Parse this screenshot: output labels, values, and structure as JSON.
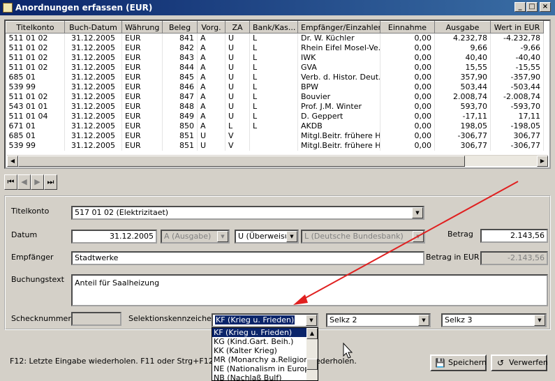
{
  "window": {
    "title": "Anordnungen erfassen (EUR)",
    "min_label": "_",
    "max_label": "□",
    "close_label": "×"
  },
  "grid": {
    "columns": [
      "Titelkonto",
      "Buch-Datum",
      "Währung",
      "Beleg",
      "Vorg.",
      "ZA",
      "Bank/Kas...",
      "Empfänger/Einzahler",
      "Einnahme",
      "Ausgabe",
      "Wert in EUR"
    ],
    "rows": [
      [
        "511 01 02",
        "31.12.2005",
        "EUR",
        "841",
        "A",
        "U",
        "L",
        "Dr. W. Küchler",
        "0,00",
        "4.232,78",
        "-4.232,78"
      ],
      [
        "511 01 02",
        "31.12.2005",
        "EUR",
        "842",
        "A",
        "U",
        "L",
        "Rhein Eifel Mosel-Ve...",
        "0,00",
        "9,66",
        "-9,66"
      ],
      [
        "511 01 02",
        "31.12.2005",
        "EUR",
        "843",
        "A",
        "U",
        "L",
        "IWK",
        "0,00",
        "40,40",
        "-40,40"
      ],
      [
        "511 01 02",
        "31.12.2005",
        "EUR",
        "844",
        "A",
        "U",
        "L",
        "GVA",
        "0,00",
        "15,55",
        "-15,55"
      ],
      [
        "685 01",
        "31.12.2005",
        "EUR",
        "845",
        "A",
        "U",
        "L",
        "Verb. d. Histor. Deut...",
        "0,00",
        "357,90",
        "-357,90"
      ],
      [
        "539 99",
        "31.12.2005",
        "EUR",
        "846",
        "A",
        "U",
        "L",
        "BPW",
        "0,00",
        "503,44",
        "-503,44"
      ],
      [
        "511 01 02",
        "31.12.2005",
        "EUR",
        "847",
        "A",
        "U",
        "L",
        "Bouvier",
        "0,00",
        "2.008,74",
        "-2.008,74"
      ],
      [
        "543 01 01",
        "31.12.2005",
        "EUR",
        "848",
        "A",
        "U",
        "L",
        "Prof. J.M. Winter",
        "0,00",
        "593,70",
        "-593,70"
      ],
      [
        "511 01 04",
        "31.12.2005",
        "EUR",
        "849",
        "A",
        "U",
        "L",
        "D. Geppert",
        "0,00",
        "-17,11",
        "17,11"
      ],
      [
        "671 01",
        "31.12.2005",
        "EUR",
        "850",
        "A",
        "L",
        "L",
        "AKDB",
        "0,00",
        "198,05",
        "-198,05"
      ],
      [
        "685 01",
        "31.12.2005",
        "EUR",
        "851",
        "U",
        "V",
        "",
        "Mitgl.Beitr. frühere H...",
        "0,00",
        "-306,77",
        "306,77"
      ],
      [
        "539 99",
        "31.12.2005",
        "EUR",
        "851",
        "U",
        "V",
        "",
        "Mitgl.Beitr. frühere H...",
        "0,00",
        "306,77",
        "-306,77"
      ]
    ]
  },
  "nav": {
    "first": "⏮",
    "prev": "◀",
    "next": "▶",
    "last": "⏭"
  },
  "form": {
    "titelkonto_label": "Titelkonto",
    "titelkonto_value": "517 01 02 (Elektrizitaet)",
    "datum_label": "Datum",
    "datum_value": "31.12.2005",
    "vorgang_value": "A (Ausgabe)",
    "zahlart_value": "U (Überweisun",
    "bank_value": "L (Deutsche Bundesbank)",
    "betrag_label": "Betrag",
    "betrag_value": "2.143,56",
    "empfaenger_label": "Empfänger",
    "empfaenger_value": "Stadtwerke",
    "betrag_eur_label": "Betrag in EUR",
    "betrag_eur_value": "-2.143,56",
    "buchungstext_label": "Buchungstext",
    "buchungstext_value": "Anteil für Saalheizung",
    "schecknummer_label": "Schecknummer",
    "schecknummer_value": "",
    "selektion_label": "Selektionskennzeichen",
    "selektion_value": "KF (Krieg u. Frieden)",
    "selkz2_value": "Selkz 2",
    "selkz3_value": "Selkz 3"
  },
  "dropdown": {
    "items": [
      "KF (Krieg u. Frieden)",
      "KG (Kind.Gart. Beih.)",
      "KK (Kalter Krieg)",
      "MR (Monarchy a.Religion)",
      "NE (Nationalism in Europ)",
      "NB (Nachlaß Bulf)"
    ]
  },
  "status": {
    "text_left": "F12: Letzte Eingabe wiederholen. F11 oder Strg+F12: Letz",
    "text_right": "ederholen."
  },
  "buttons": {
    "save": "Speichern",
    "discard": "Verwerfen"
  },
  "colors": {
    "titlebar": "#0a246a",
    "highlight": "#0a246a",
    "annotation_arrow": "#e02020"
  }
}
